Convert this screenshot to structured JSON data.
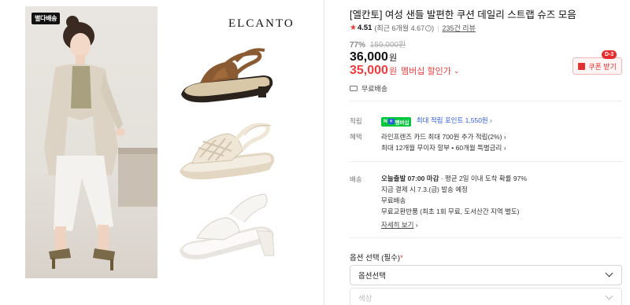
{
  "image_area": {
    "badge": "별다배송",
    "brand_logo": "ELCANTO"
  },
  "product": {
    "title": "[엘칸토] 여성 샌들 발편한 쿠션 데일리 스트랩 슈즈 모음",
    "rating": "4.51",
    "rating_detail": "(최근 6개월 4.67",
    "rating_detail_close": ")",
    "review_count": "235건 리뷰",
    "discount_rate": "77%",
    "original_price": "159,000원",
    "price": "36,000",
    "price_unit": "원",
    "member_price": "35,000",
    "member_price_unit": "원",
    "member_label": "멤버십 할인가",
    "free_shipping_top": "무료배송"
  },
  "coupon": {
    "label": "쿠폰 받기",
    "dday": "D-3"
  },
  "points": {
    "label": "적립",
    "badge_n": "N",
    "badge_plus": "+",
    "badge_text": "멤버십",
    "text": "최대 적립 포인트 1,550원",
    "chevron": "›"
  },
  "benefits": {
    "label": "혜택",
    "line1": "라인프렌즈 카드 최대 700원 추가 적립(2%)",
    "line2": "최대 12개월 무이자 할부 • 60개월 특별금리",
    "chevron": "›"
  },
  "delivery": {
    "label": "배송",
    "line1_bold": "오늘출발 07:00 마감",
    "line1_rest": " · 평균 2일 이내 도착 확률 97%",
    "line2": "지금 결제 시 7.3.(금) 발송 예정",
    "line3": "무료배송",
    "line4": "무료교환반품 (최초 1회 무료, 도서산간 지역 별도)",
    "details_link": "자세히 보기",
    "chevron": "›"
  },
  "options": {
    "label": "옵션 선택 (필수)",
    "required_mark": "*",
    "select1": "옵션선택",
    "select2": "색상"
  },
  "colors": {
    "accent_red": "#f03c3c",
    "point_blue": "#2f5fe0",
    "naver_green": "#00c73c"
  }
}
